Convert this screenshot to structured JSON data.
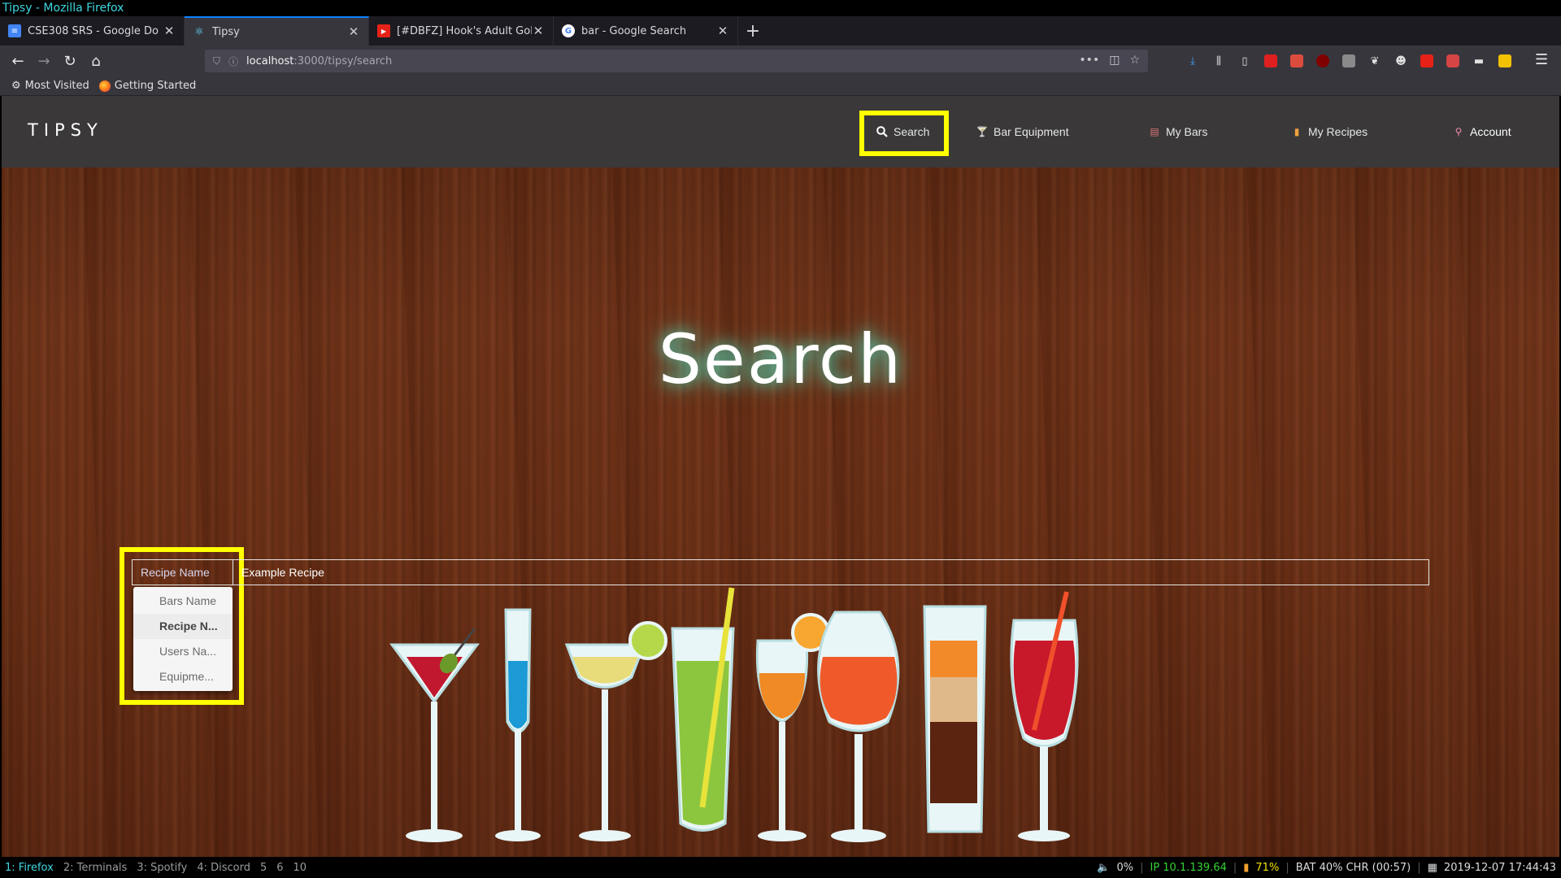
{
  "window_title": "Tipsy - Mozilla Firefox",
  "browser": {
    "tabs": [
      {
        "label": "CSE308 SRS - Google Do",
        "favicon": "google-docs-icon",
        "active": false
      },
      {
        "label": "Tipsy",
        "favicon": "react-icon",
        "active": true
      },
      {
        "label": "[#DBFZ] Hook's Adult Goh",
        "favicon": "youtube-icon",
        "active": false
      },
      {
        "label": "bar - Google Search",
        "favicon": "google-icon",
        "active": false
      }
    ],
    "new_tab_label": "+",
    "url_host": "localhost",
    "url_path": ":3000/tipsy/search",
    "bookmarks": [
      {
        "label": "Most Visited",
        "icon": "gear-icon"
      },
      {
        "label": "Getting Started",
        "icon": "firefox-icon"
      }
    ]
  },
  "site": {
    "brand": "TIPSY",
    "nav": [
      {
        "label": "Search",
        "icon": "search-icon"
      },
      {
        "label": "Bar Equipment",
        "icon": "equipment-icon"
      },
      {
        "label": "My Bars",
        "icon": "bar-icon"
      },
      {
        "label": "My Recipes",
        "icon": "bottle-icon"
      },
      {
        "label": "Account",
        "icon": "account-icon"
      }
    ],
    "hero_title": "Search",
    "search": {
      "filter_selected": "Recipe Name",
      "input_value": "Example Recipe",
      "filter_options": [
        "Bars Name",
        "Recipe N...",
        "Users Na...",
        "Equipme..."
      ],
      "selected_option_index": 1
    }
  },
  "statusbar": {
    "workspaces": [
      "1: Firefox",
      "2: Terminals",
      "3: Spotify",
      "4: Discord",
      "5",
      "6",
      "10"
    ],
    "volume": "0%",
    "ip": "IP 10.1.139.64",
    "wifi": "71%",
    "battery": "BAT 40% CHR (00:57)",
    "datetime": "2019-12-07 17:44:43"
  },
  "colors": {
    "highlight": "#ffff00",
    "site_nav_bg": "#3a3838",
    "wood": "#6a2f15",
    "glow": "#50e6c8",
    "tab_accent": "#0a84ff"
  }
}
